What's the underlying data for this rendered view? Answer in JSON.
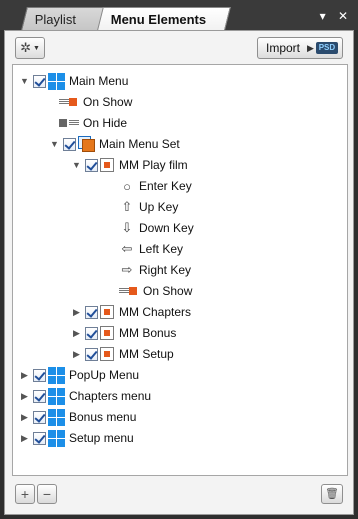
{
  "tabs": {
    "playlist": "Playlist",
    "menu_elements": "Menu Elements"
  },
  "title_controls": {
    "dropdown": "▾",
    "close": "✕"
  },
  "toolbar": {
    "gear_icon": "✲",
    "import_label": "Import",
    "import_badge": "PSD"
  },
  "tree": {
    "main_menu": "Main Menu",
    "on_show": "On Show",
    "on_hide": "On Hide",
    "main_menu_set": "Main Menu Set",
    "mm_play_film": "MM Play film",
    "enter_key": "Enter Key",
    "up_key": "Up Key",
    "down_key": "Down Key",
    "left_key": "Left Key",
    "right_key": "Right Key",
    "on_show_2": "On Show",
    "mm_chapters": "MM Chapters",
    "mm_bonus": "MM Bonus",
    "mm_setup": "MM Setup",
    "popup_menu": "PopUp Menu",
    "chapters_menu": "Chapters menu",
    "bonus_menu": "Bonus menu",
    "setup_menu": "Setup menu"
  },
  "bottom": {
    "add": "+",
    "remove": "−",
    "trash": "🗑"
  },
  "colors": {
    "accent": "#1c8fe8",
    "orange": "#e5591b"
  }
}
